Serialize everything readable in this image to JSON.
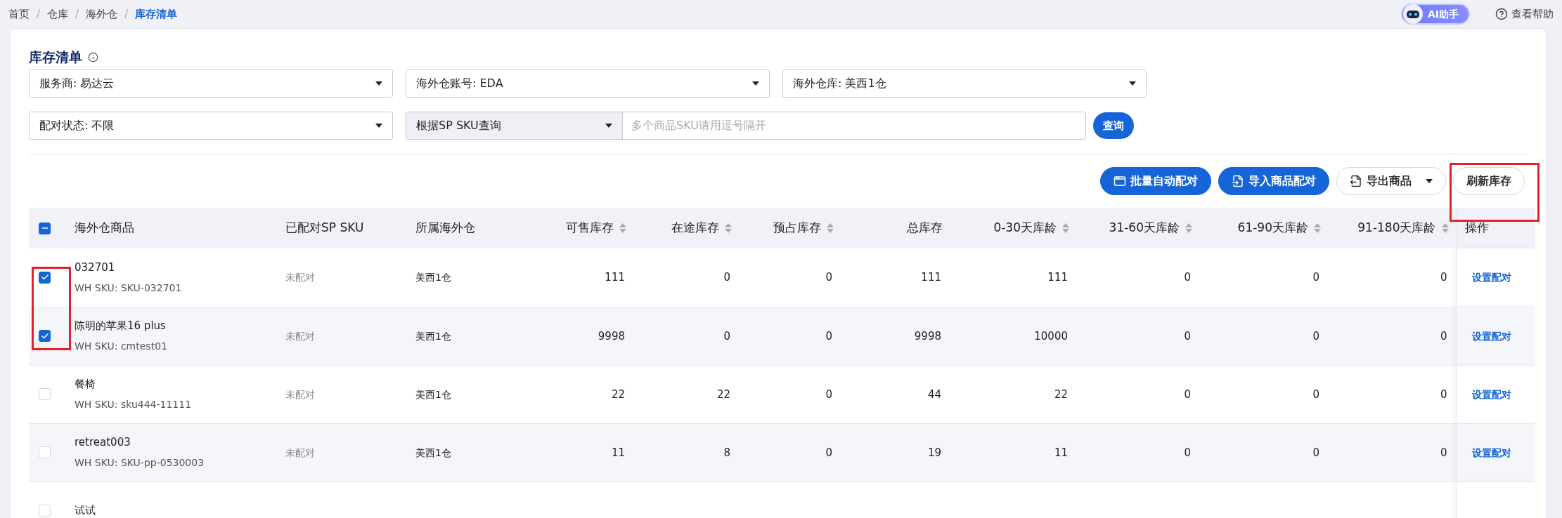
{
  "breadcrumb": [
    {
      "label": "首页",
      "current": false
    },
    {
      "separator": "/",
      "label": "仓库",
      "current": false
    },
    {
      "separator": "/",
      "label": "海外仓",
      "current": false
    },
    {
      "separator": "/",
      "label": "库存清单",
      "current": true
    }
  ],
  "ai_assistant": {
    "label": "AI助手"
  },
  "help": {
    "label": "查看帮助"
  },
  "page": {
    "title": "库存清单"
  },
  "filters": [
    {
      "label": "服务商: 易达云"
    },
    {
      "label": "海外仓账号: EDA"
    },
    {
      "label": "海外仓库: 美西1仓"
    },
    {
      "label": "配对状态: 不限"
    }
  ],
  "search": {
    "mode": "根据SP SKU查询",
    "placeholder": "多个商品SKU请用逗号隔开",
    "button": "查询"
  },
  "toolbar": [
    {
      "label": "批量自动配对",
      "kind": "primary"
    },
    {
      "label": "导入商品配对",
      "kind": "primary"
    },
    {
      "label": "导出商品",
      "kind": "dropdown"
    },
    {
      "label": "刷新库存",
      "kind": "plain"
    }
  ],
  "table": {
    "select_all_partial": true,
    "columns": [
      {
        "label": "海外仓商品",
        "sortable": false
      },
      {
        "label": "已配对SP SKU",
        "sortable": false
      },
      {
        "label": "所属海外仓",
        "sortable": false
      },
      {
        "label": "可售库存",
        "sortable": true
      },
      {
        "label": "在途库存",
        "sortable": true
      },
      {
        "label": "预占库存",
        "sortable": true
      },
      {
        "label": "总库存",
        "sortable": false
      },
      {
        "label": "0-30天库龄",
        "sortable": true
      },
      {
        "label": "31-60天库龄",
        "sortable": true
      },
      {
        "label": "61-90天库龄",
        "sortable": true
      },
      {
        "label": "91-180天库龄",
        "sortable": true
      },
      {
        "label": "操作",
        "sortable": false
      }
    ],
    "rows": [
      {
        "selected": true,
        "name": "032701",
        "wh_sku": "WH SKU: SKU-032701",
        "paired": "未配对",
        "warehouse": "美西1仓",
        "values": [
          "111",
          "0",
          "0",
          "111",
          "111",
          "0",
          "0",
          "0"
        ],
        "action": "设置配对"
      },
      {
        "selected": true,
        "name": "陈明的苹果16 plus",
        "wh_sku": "WH SKU: cmtest01",
        "paired": "未配对",
        "warehouse": "美西1仓",
        "values": [
          "9998",
          "0",
          "0",
          "9998",
          "10000",
          "0",
          "0",
          "0"
        ],
        "action": "设置配对"
      },
      {
        "selected": false,
        "name": "餐椅",
        "wh_sku": "WH SKU: sku444-11111",
        "paired": "未配对",
        "warehouse": "美西1仓",
        "values": [
          "22",
          "22",
          "0",
          "44",
          "22",
          "0",
          "0",
          "0"
        ],
        "action": "设置配对"
      },
      {
        "selected": false,
        "name": "retreat003",
        "wh_sku": "WH SKU: SKU-pp-0530003",
        "paired": "未配对",
        "warehouse": "美西1仓",
        "values": [
          "11",
          "8",
          "0",
          "19",
          "11",
          "0",
          "0",
          "0"
        ],
        "action": "设置配对"
      },
      {
        "selected": false,
        "name": "试试"
      }
    ]
  }
}
